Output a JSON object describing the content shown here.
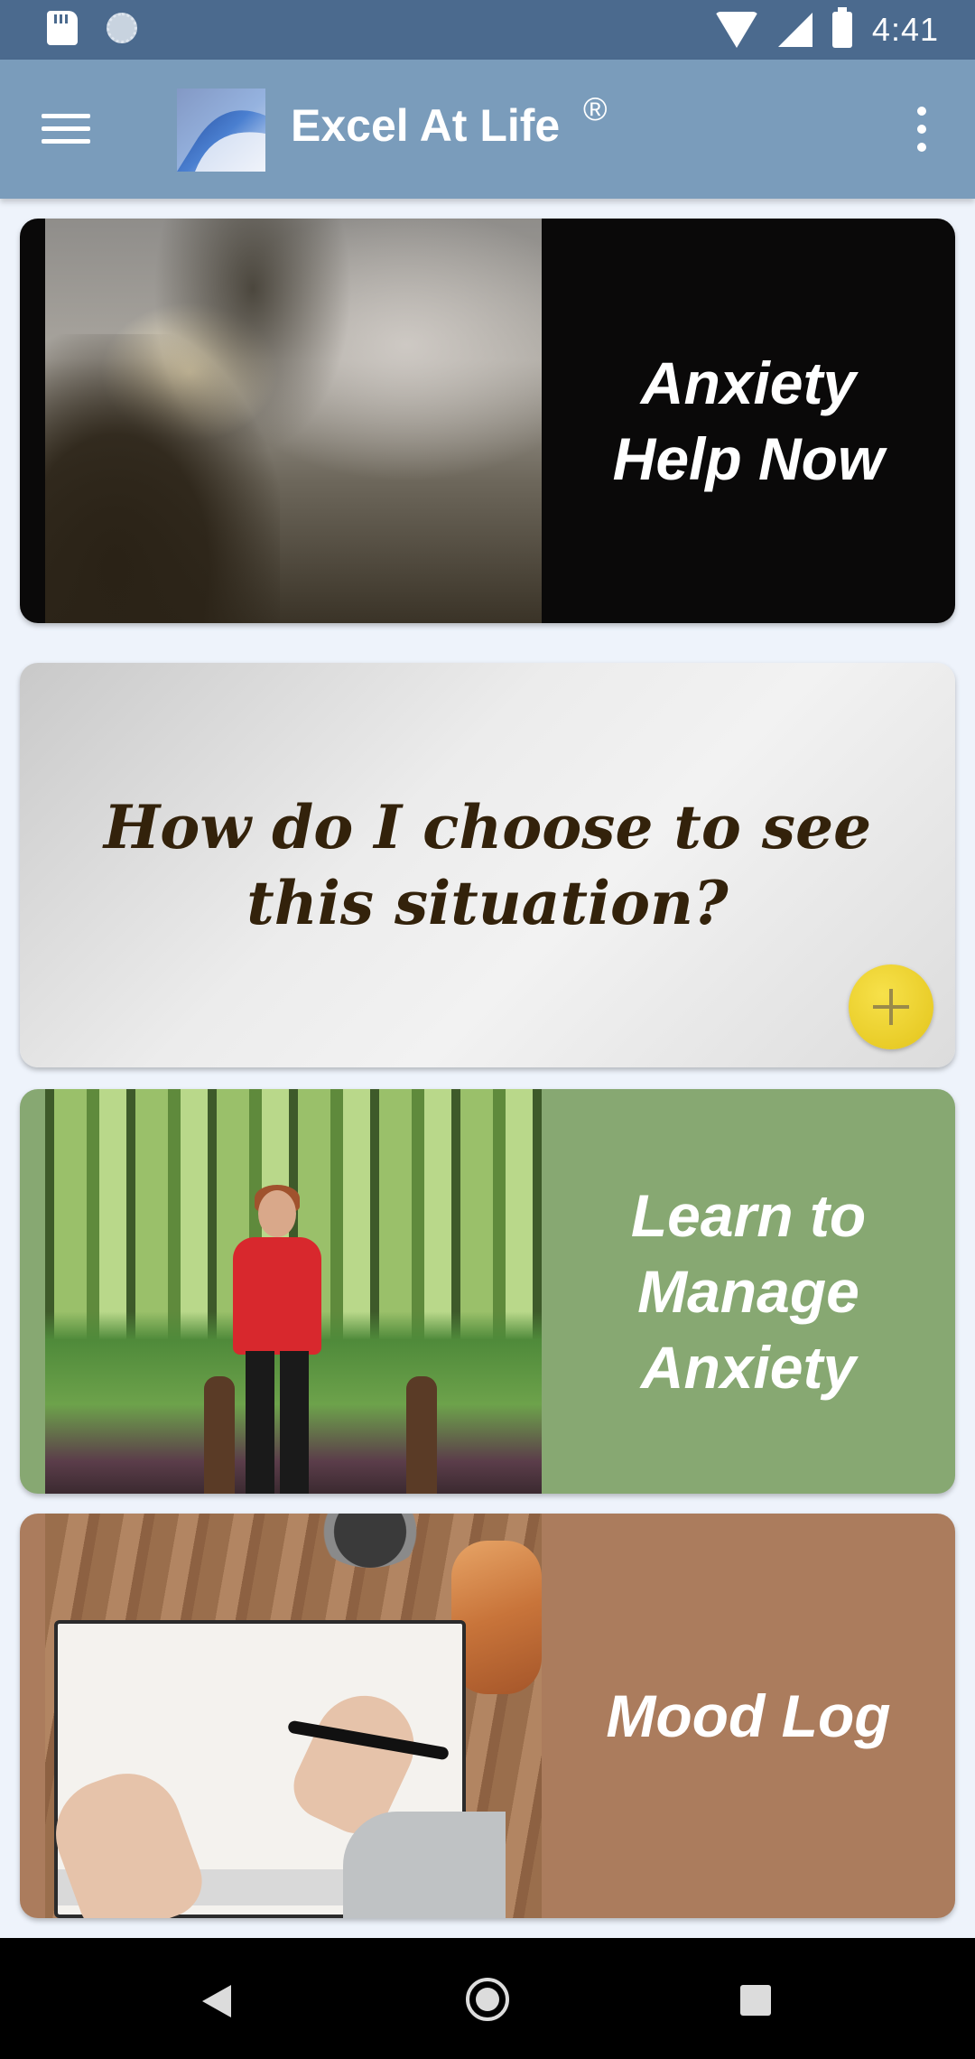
{
  "status_bar": {
    "time": "4:41",
    "icons": [
      "sd-card-icon",
      "sync-icon",
      "wifi-icon",
      "signal-icon",
      "battery-icon"
    ]
  },
  "app_bar": {
    "title": "Excel At Life",
    "registered_mark": "®",
    "icons": [
      "menu-icon",
      "app-logo",
      "overflow-menu-icon"
    ],
    "color": "#7a9cbb"
  },
  "cards": [
    {
      "label_lines": [
        "Anxiety",
        "Help Now"
      ],
      "panel_color": "#0a0909",
      "image": "foggy-forest-sunrise"
    },
    {
      "text": "How do I choose to see this situation?",
      "text_color": "#33220b",
      "fab_icon": "plus-icon",
      "fab_color": "#f0d331"
    },
    {
      "label_lines": [
        "Learn to",
        "Manage",
        "Anxiety"
      ],
      "panel_color": "#87a872",
      "image": "woman-exercising-outdoors"
    },
    {
      "label_lines": [
        "Mood Log"
      ],
      "panel_color": "#ab7c5d",
      "image": "writing-in-notebook"
    }
  ],
  "nav_bar": {
    "icons": [
      "back-icon",
      "home-icon",
      "recents-icon"
    ]
  }
}
